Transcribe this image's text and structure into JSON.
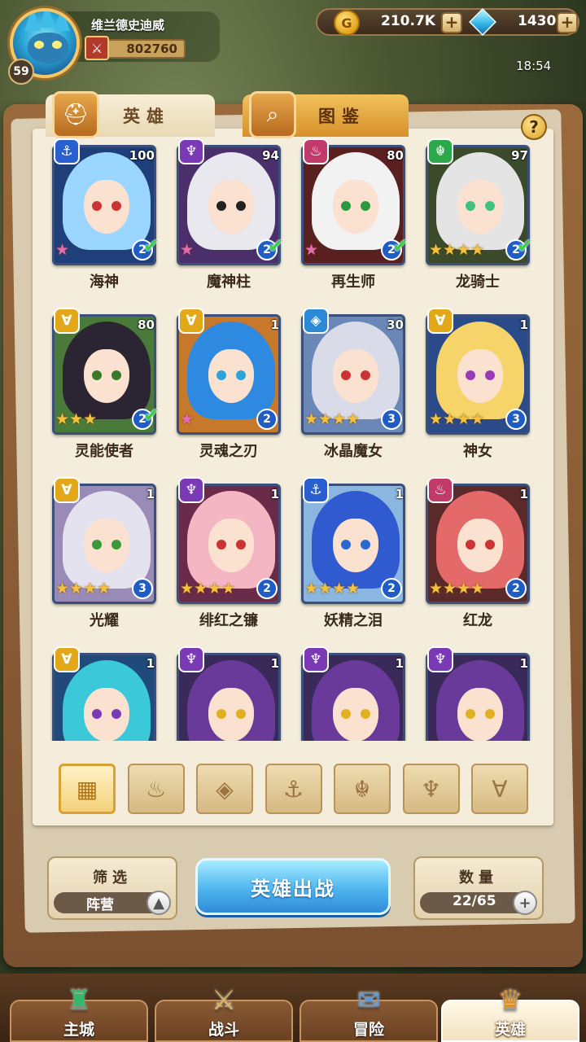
{
  "player": {
    "name": "维兰德史迪威",
    "level": "59",
    "power": "802760"
  },
  "currency": {
    "gold": "210.7K",
    "gems": "1430"
  },
  "clock": "18:54",
  "tabs": [
    {
      "label": "英雄",
      "active": true
    },
    {
      "label": "图鉴",
      "active": false
    }
  ],
  "help": "?",
  "heroes": [
    {
      "name": "海神",
      "level": "100",
      "faction": "anchor",
      "stars": 1,
      "star_type": "rainbow",
      "grade": "2",
      "checked": true,
      "hair": "#9ad6ff",
      "bg": "#1f3f7a",
      "eye": "#c33"
    },
    {
      "name": "魔神柱",
      "level": "94",
      "faction": "demon",
      "stars": 1,
      "star_type": "rainbow",
      "grade": "2",
      "checked": true,
      "hair": "#e8e8ee",
      "bg": "#4b2f6a",
      "eye": "#222"
    },
    {
      "name": "再生师",
      "level": "80",
      "faction": "flame",
      "stars": 1,
      "star_type": "rainbow",
      "grade": "2",
      "checked": true,
      "hair": "#f2f2f2",
      "bg": "#5a2020",
      "eye": "#2b9a3e"
    },
    {
      "name": "龙骑士",
      "level": "97",
      "faction": "dragon",
      "stars": 4,
      "star_type": "gold",
      "grade": "2",
      "checked": true,
      "hair": "#e4e4e4",
      "bg": "#3b4a2a",
      "eye": "#3fc27a"
    },
    {
      "name": "灵能使者",
      "level": "80",
      "faction": "light",
      "stars": 3,
      "star_type": "gold",
      "grade": "2",
      "checked": true,
      "hair": "#2b2433",
      "bg": "#4a7a3a",
      "eye": "#3a7a2a"
    },
    {
      "name": "灵魂之刃",
      "level": "1",
      "faction": "light",
      "stars": 1,
      "star_type": "rainbow",
      "grade": "2",
      "checked": false,
      "hair": "#2e8ae0",
      "bg": "#c7782a",
      "eye": "#2aa3d8"
    },
    {
      "name": "冰晶魔女",
      "level": "30",
      "faction": "ice",
      "stars": 4,
      "star_type": "gold",
      "grade": "3",
      "checked": false,
      "hair": "#d9dce8",
      "bg": "#6a87b8",
      "eye": "#c33"
    },
    {
      "name": "神女",
      "level": "1",
      "faction": "light",
      "stars": 4,
      "star_type": "gold",
      "grade": "3",
      "checked": false,
      "hair": "#f6d46a",
      "bg": "#2a4a8a",
      "eye": "#9a3ab5"
    },
    {
      "name": "光耀",
      "level": "1",
      "faction": "light",
      "stars": 4,
      "star_type": "gold",
      "grade": "3",
      "checked": false,
      "hair": "#e4e2ee",
      "bg": "#9a8ab8",
      "eye": "#3a9a3a"
    },
    {
      "name": "绯红之镰",
      "level": "1",
      "faction": "demon",
      "stars": 4,
      "star_type": "gold",
      "grade": "2",
      "checked": false,
      "hair": "#f5b6c4",
      "bg": "#6a2a4a",
      "eye": "#c33"
    },
    {
      "name": "妖精之泪",
      "level": "1",
      "faction": "anchor",
      "stars": 4,
      "star_type": "gold",
      "grade": "2",
      "checked": false,
      "hair": "#2f5ad0",
      "bg": "#8ab6e0",
      "eye": "#2a6ad0"
    },
    {
      "name": "红龙",
      "level": "1",
      "faction": "flame",
      "stars": 4,
      "star_type": "gold",
      "grade": "2",
      "checked": false,
      "hair": "#e46a6a",
      "bg": "#5a2a2a",
      "eye": "#c33"
    },
    {
      "name": "",
      "level": "1",
      "faction": "light",
      "stars": 0,
      "star_type": "gold",
      "grade": "",
      "checked": false,
      "hair": "#3bc8d8",
      "bg": "#1f4a7a",
      "eye": "#7a3ab5"
    },
    {
      "name": "",
      "level": "1",
      "faction": "demon",
      "stars": 0,
      "star_type": "gold",
      "grade": "",
      "checked": false,
      "hair": "#6a3a9a",
      "bg": "#3a2a5a",
      "eye": "#e0b020"
    },
    {
      "name": "",
      "level": "1",
      "faction": "demon",
      "stars": 0,
      "star_type": "gold",
      "grade": "",
      "checked": false,
      "hair": "#6a3a9a",
      "bg": "#3a2a5a",
      "eye": "#e0b020"
    },
    {
      "name": "",
      "level": "1",
      "faction": "demon",
      "stars": 0,
      "star_type": "gold",
      "grade": "",
      "checked": false,
      "hair": "#6a3a9a",
      "bg": "#3a2a5a",
      "eye": "#e0b020"
    }
  ],
  "faction_colors": {
    "anchor": "#2a5fd0",
    "demon": "#7a3ab5",
    "flame": "#c23a6a",
    "dragon": "#2aa84a",
    "light": "#e2a81a",
    "ice": "#2a8ad6"
  },
  "faction_glyphs": {
    "anchor": "⚓",
    "demon": "♆",
    "flame": "♨",
    "dragon": "☬",
    "light": "∀",
    "ice": "◈"
  },
  "filters": [
    {
      "icon": "grid-icon",
      "glyph": "▦",
      "active": true
    },
    {
      "icon": "flame-icon",
      "glyph": "♨",
      "active": false
    },
    {
      "icon": "ice-icon",
      "glyph": "◈",
      "active": false
    },
    {
      "icon": "anchor-icon",
      "glyph": "⚓",
      "active": false
    },
    {
      "icon": "dragon-icon",
      "glyph": "☬",
      "active": false
    },
    {
      "icon": "demon-icon",
      "glyph": "♆",
      "active": false
    },
    {
      "icon": "light-icon",
      "glyph": "∀",
      "active": false
    }
  ],
  "filter_panel": {
    "title": "筛选",
    "value": "阵营"
  },
  "deploy_button": "英雄出战",
  "count_panel": {
    "title": "数量",
    "value": "22/65"
  },
  "nav": [
    {
      "label": "主城",
      "icon": "castle-icon",
      "active": false
    },
    {
      "label": "战斗",
      "icon": "crossed-swords-icon",
      "active": false
    },
    {
      "label": "冒险",
      "icon": "scroll-map-icon",
      "active": false
    },
    {
      "label": "英雄",
      "icon": "hero-crest-icon",
      "active": true
    }
  ]
}
